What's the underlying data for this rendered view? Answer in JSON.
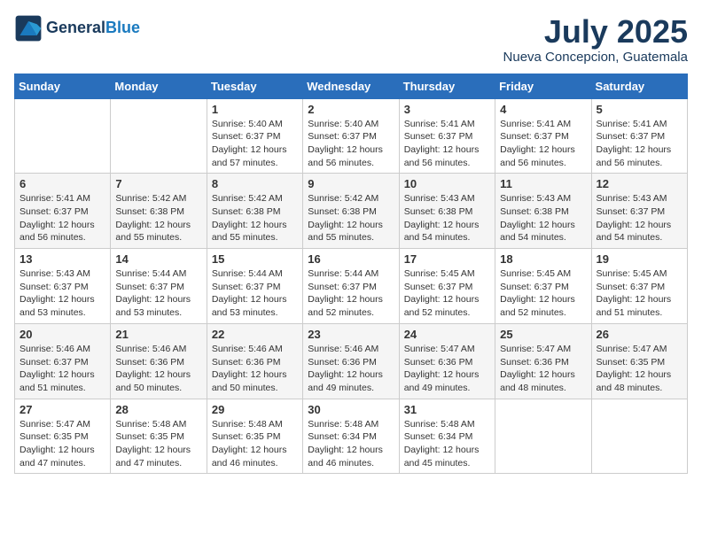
{
  "header": {
    "logo_line1": "General",
    "logo_line2": "Blue",
    "month": "July 2025",
    "location": "Nueva Concepcion, Guatemala"
  },
  "weekdays": [
    "Sunday",
    "Monday",
    "Tuesday",
    "Wednesday",
    "Thursday",
    "Friday",
    "Saturday"
  ],
  "weeks": [
    [
      {
        "day": "",
        "content": ""
      },
      {
        "day": "",
        "content": ""
      },
      {
        "day": "1",
        "content": "Sunrise: 5:40 AM\nSunset: 6:37 PM\nDaylight: 12 hours and 57 minutes."
      },
      {
        "day": "2",
        "content": "Sunrise: 5:40 AM\nSunset: 6:37 PM\nDaylight: 12 hours and 56 minutes."
      },
      {
        "day": "3",
        "content": "Sunrise: 5:41 AM\nSunset: 6:37 PM\nDaylight: 12 hours and 56 minutes."
      },
      {
        "day": "4",
        "content": "Sunrise: 5:41 AM\nSunset: 6:37 PM\nDaylight: 12 hours and 56 minutes."
      },
      {
        "day": "5",
        "content": "Sunrise: 5:41 AM\nSunset: 6:37 PM\nDaylight: 12 hours and 56 minutes."
      }
    ],
    [
      {
        "day": "6",
        "content": "Sunrise: 5:41 AM\nSunset: 6:37 PM\nDaylight: 12 hours and 56 minutes."
      },
      {
        "day": "7",
        "content": "Sunrise: 5:42 AM\nSunset: 6:38 PM\nDaylight: 12 hours and 55 minutes."
      },
      {
        "day": "8",
        "content": "Sunrise: 5:42 AM\nSunset: 6:38 PM\nDaylight: 12 hours and 55 minutes."
      },
      {
        "day": "9",
        "content": "Sunrise: 5:42 AM\nSunset: 6:38 PM\nDaylight: 12 hours and 55 minutes."
      },
      {
        "day": "10",
        "content": "Sunrise: 5:43 AM\nSunset: 6:38 PM\nDaylight: 12 hours and 54 minutes."
      },
      {
        "day": "11",
        "content": "Sunrise: 5:43 AM\nSunset: 6:38 PM\nDaylight: 12 hours and 54 minutes."
      },
      {
        "day": "12",
        "content": "Sunrise: 5:43 AM\nSunset: 6:37 PM\nDaylight: 12 hours and 54 minutes."
      }
    ],
    [
      {
        "day": "13",
        "content": "Sunrise: 5:43 AM\nSunset: 6:37 PM\nDaylight: 12 hours and 53 minutes."
      },
      {
        "day": "14",
        "content": "Sunrise: 5:44 AM\nSunset: 6:37 PM\nDaylight: 12 hours and 53 minutes."
      },
      {
        "day": "15",
        "content": "Sunrise: 5:44 AM\nSunset: 6:37 PM\nDaylight: 12 hours and 53 minutes."
      },
      {
        "day": "16",
        "content": "Sunrise: 5:44 AM\nSunset: 6:37 PM\nDaylight: 12 hours and 52 minutes."
      },
      {
        "day": "17",
        "content": "Sunrise: 5:45 AM\nSunset: 6:37 PM\nDaylight: 12 hours and 52 minutes."
      },
      {
        "day": "18",
        "content": "Sunrise: 5:45 AM\nSunset: 6:37 PM\nDaylight: 12 hours and 52 minutes."
      },
      {
        "day": "19",
        "content": "Sunrise: 5:45 AM\nSunset: 6:37 PM\nDaylight: 12 hours and 51 minutes."
      }
    ],
    [
      {
        "day": "20",
        "content": "Sunrise: 5:46 AM\nSunset: 6:37 PM\nDaylight: 12 hours and 51 minutes."
      },
      {
        "day": "21",
        "content": "Sunrise: 5:46 AM\nSunset: 6:36 PM\nDaylight: 12 hours and 50 minutes."
      },
      {
        "day": "22",
        "content": "Sunrise: 5:46 AM\nSunset: 6:36 PM\nDaylight: 12 hours and 50 minutes."
      },
      {
        "day": "23",
        "content": "Sunrise: 5:46 AM\nSunset: 6:36 PM\nDaylight: 12 hours and 49 minutes."
      },
      {
        "day": "24",
        "content": "Sunrise: 5:47 AM\nSunset: 6:36 PM\nDaylight: 12 hours and 49 minutes."
      },
      {
        "day": "25",
        "content": "Sunrise: 5:47 AM\nSunset: 6:36 PM\nDaylight: 12 hours and 48 minutes."
      },
      {
        "day": "26",
        "content": "Sunrise: 5:47 AM\nSunset: 6:35 PM\nDaylight: 12 hours and 48 minutes."
      }
    ],
    [
      {
        "day": "27",
        "content": "Sunrise: 5:47 AM\nSunset: 6:35 PM\nDaylight: 12 hours and 47 minutes."
      },
      {
        "day": "28",
        "content": "Sunrise: 5:48 AM\nSunset: 6:35 PM\nDaylight: 12 hours and 47 minutes."
      },
      {
        "day": "29",
        "content": "Sunrise: 5:48 AM\nSunset: 6:35 PM\nDaylight: 12 hours and 46 minutes."
      },
      {
        "day": "30",
        "content": "Sunrise: 5:48 AM\nSunset: 6:34 PM\nDaylight: 12 hours and 46 minutes."
      },
      {
        "day": "31",
        "content": "Sunrise: 5:48 AM\nSunset: 6:34 PM\nDaylight: 12 hours and 45 minutes."
      },
      {
        "day": "",
        "content": ""
      },
      {
        "day": "",
        "content": ""
      }
    ]
  ]
}
